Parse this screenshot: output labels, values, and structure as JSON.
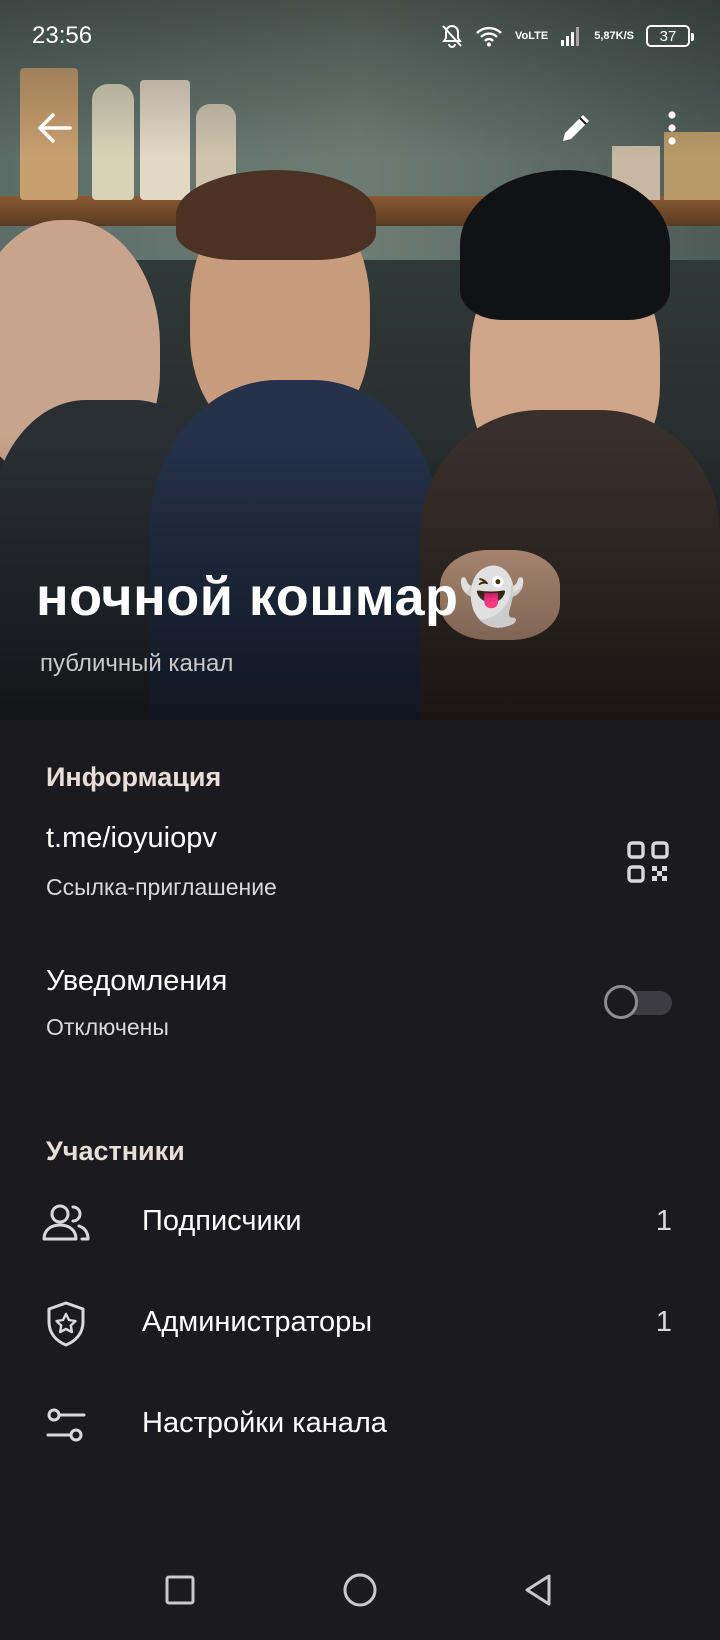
{
  "status_bar": {
    "time": "23:56",
    "lte_top": "Vo",
    "lte_bottom": "LTE",
    "speed_value": "5,87",
    "speed_unit": "K/S",
    "battery": "37"
  },
  "header": {
    "channel_name": "ночной кошмар👻",
    "channel_type": "публичный канал"
  },
  "info": {
    "section_title": "Информация",
    "link": "t.me/ioyuiopv",
    "link_label": "Ссылка-приглашение",
    "notifications_title": "Уведомления",
    "notifications_state": "Отключены",
    "notifications_enabled": false
  },
  "members": {
    "section_title": "Участники",
    "items": [
      {
        "label": "Подписчики",
        "count": "1",
        "icon": "people-icon"
      },
      {
        "label": "Администраторы",
        "count": "1",
        "icon": "admin-shield-icon"
      },
      {
        "label": "Настройки канала",
        "count": "",
        "icon": "sliders-icon"
      }
    ]
  },
  "colors": {
    "background": "#1b1b1f",
    "section_title": "#e9ded8",
    "secondary_text": "#d9d9dc"
  }
}
